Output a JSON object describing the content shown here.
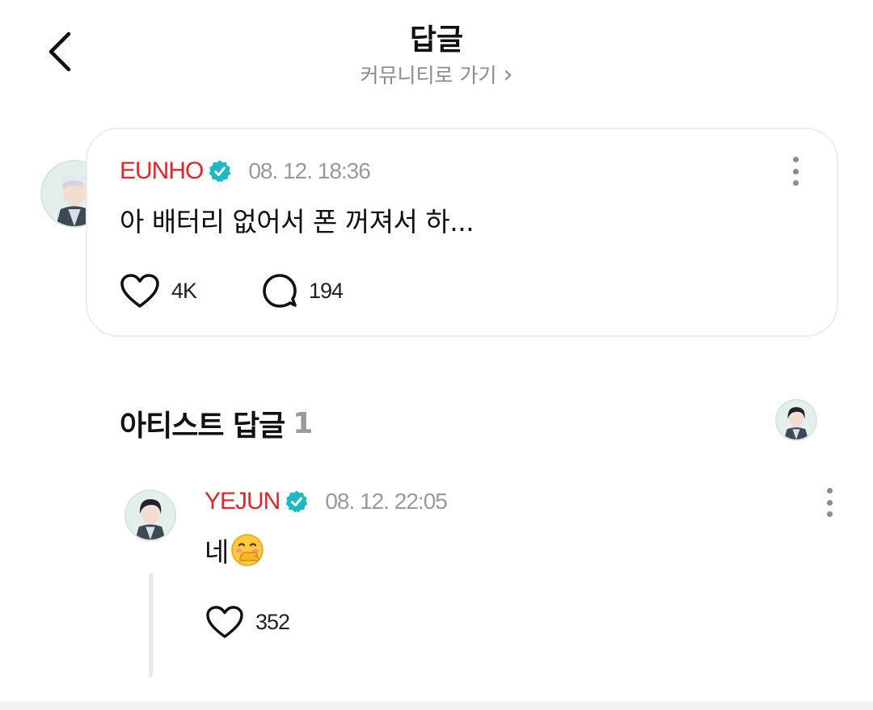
{
  "header": {
    "title": "답글",
    "community_link": "커뮤니티로 가기",
    "community_arrow": "›"
  },
  "post": {
    "author": "EUNHO",
    "date": "08. 12. 18:36",
    "text": "아 배터리 없어서 폰 꺼져서 하...",
    "likes": "4K",
    "comments": "194"
  },
  "artist_replies": {
    "title": "아티스트 답글",
    "count": "1"
  },
  "reply": {
    "author": "YEJUN",
    "date": "08. 12. 22:05",
    "text": "네",
    "emoji": "🤭",
    "likes": "352"
  },
  "colors": {
    "author": "#e0252b",
    "verified": "#1cb8c4",
    "muted": "#9a9a9a"
  },
  "icons": [
    "back-arrow-icon",
    "verified-badge-icon",
    "more-icon",
    "heart-icon",
    "comment-icon"
  ]
}
